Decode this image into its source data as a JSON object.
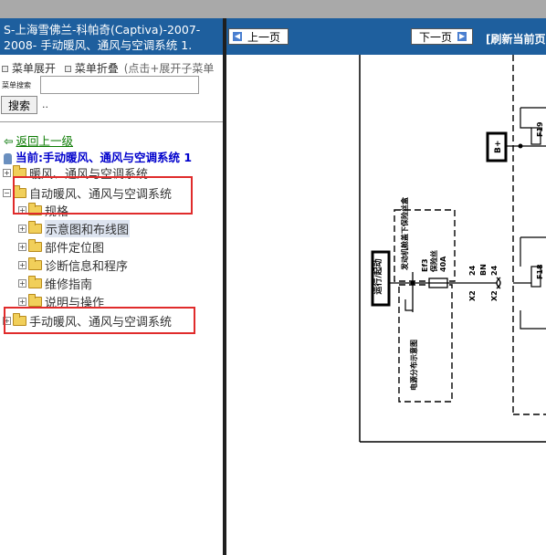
{
  "left_panel": {
    "title_line1": "S-上海雪佛兰-科帕奇(Captiva)-2007-",
    "title_line2": "2008- 手动暖风、通风与空调系统 1.",
    "menu_expand": "菜单展开",
    "menu_collapse": "菜单折叠",
    "menu_hint": "(点击+展开子菜单",
    "search_label": "菜单搜索",
    "search_placeholder": "",
    "search_button": "搜索",
    "search_dots": "..",
    "back_link": "返回上一级",
    "current_label": "当前:手动暖风、通风与空调系统 1",
    "tree": [
      {
        "label": "暖风、通风与空调系统"
      },
      {
        "label": "自动暖风、通风与空调系统"
      },
      {
        "label": "规格"
      },
      {
        "label": "示意图和布线图"
      },
      {
        "label": "部件定位图"
      },
      {
        "label": "诊断信息和程序"
      },
      {
        "label": "维修指南"
      },
      {
        "label": "说明与操作"
      },
      {
        "label": "手动暖风、通风与空调系统"
      }
    ],
    "annotation_color": "#e02b2b",
    "header_color": "#1e5f9e"
  },
  "right_panel": {
    "prev_button": "上一页",
    "next_button": "下一页",
    "refresh_link": "[刷新当前页",
    "diagram": {
      "label_run_start": "运行/起动",
      "label_fuse_panel": "发动机舱盖下保险丝盒",
      "label_fuse": "保险丝",
      "fuse_id": "Ef3",
      "fuse_rating": "40A",
      "label_power_dist": "电源分布示意图",
      "wire_24a": "24",
      "wire_bn": "BN",
      "wire_24b": "24",
      "connector_x2a": "X2",
      "connector_x2b": "X2",
      "label_bplus": "B+",
      "fuse_f19": "F19",
      "fuse_f18": "F18"
    }
  }
}
